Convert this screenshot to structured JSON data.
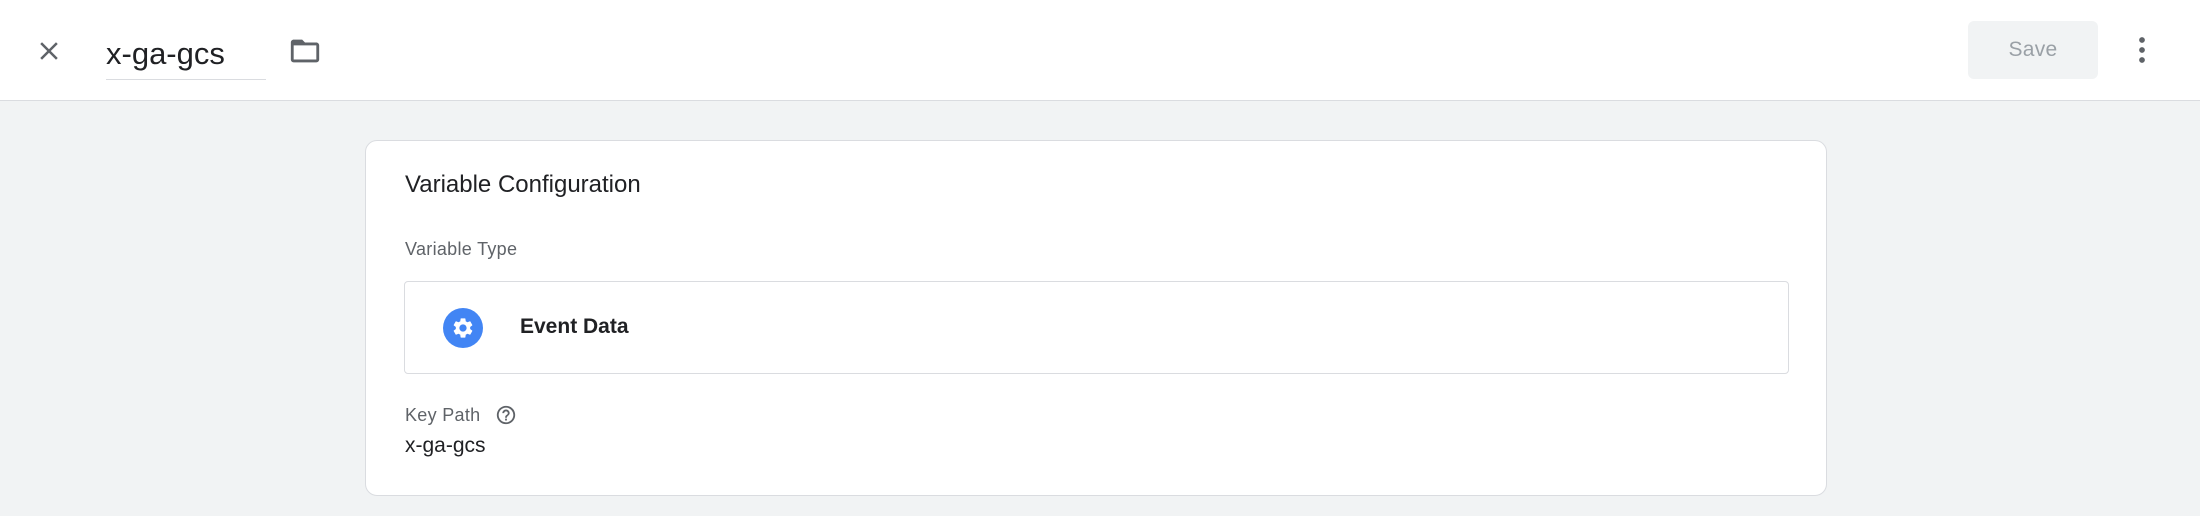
{
  "header": {
    "variable_name": "x-ga-gcs",
    "save_label": "Save",
    "icons": {
      "close": "close-icon",
      "folder": "folder-icon",
      "more": "more-vert-icon"
    }
  },
  "card": {
    "title": "Variable Configuration",
    "variable_type_label": "Variable Type",
    "variable_type": {
      "name": "Event Data",
      "icon": "gear-icon",
      "icon_color": "#4285f4"
    },
    "key_path_label": "Key Path",
    "key_path_value": "x-ga-gcs",
    "help_icon": "help-icon"
  },
  "colors": {
    "accent": "#4285f4",
    "save_disabled_text": "#9aa0a6",
    "background": "#f1f3f4"
  }
}
